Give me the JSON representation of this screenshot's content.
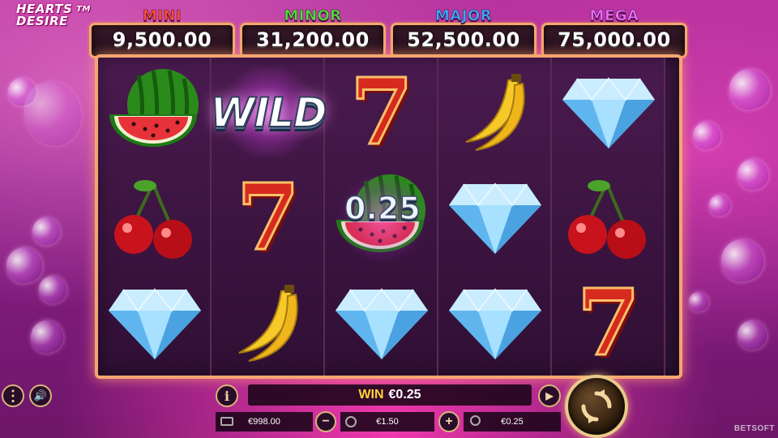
{
  "logo": {
    "line1": "HEARTS",
    "line2": "DESIRE",
    "tm": "TM"
  },
  "jackpots": [
    {
      "name": "MINI",
      "value": "9,500.00",
      "color": "#ff4a3a"
    },
    {
      "name": "MINOR",
      "value": "31,200.00",
      "color": "#4fdc3a"
    },
    {
      "name": "MAJOR",
      "value": "52,500.00",
      "color": "#3ea6ff"
    },
    {
      "name": "MEGA",
      "value": "75,000.00",
      "color": "#e86cff"
    }
  ],
  "reels": [
    [
      "watermelon",
      "cherry",
      "diamond"
    ],
    [
      "wild",
      "seven",
      "banana"
    ],
    [
      "seven",
      "watermelon",
      "diamond"
    ],
    [
      "banana",
      "diamond",
      "diamond"
    ],
    [
      "diamond",
      "cherry",
      "seven"
    ]
  ],
  "symbols": {
    "wild": "WILD",
    "seven": "7"
  },
  "coin_win": {
    "reel": 2,
    "row": 1,
    "amount": "0.25"
  },
  "bottom": {
    "menu_icon": "menu-icon",
    "sound_icon": "speaker-icon",
    "info_label": "i",
    "win_label": "WIN",
    "win_value": "€0.25",
    "balance": "€998.00",
    "bet": "€1.50",
    "last_win": "€0.25",
    "minus": "−",
    "plus": "+",
    "brand": "BETSOFT"
  },
  "colors": {
    "frame": "#f4a670",
    "win_label": "#ffd23a",
    "seven": "#d62a1e"
  }
}
